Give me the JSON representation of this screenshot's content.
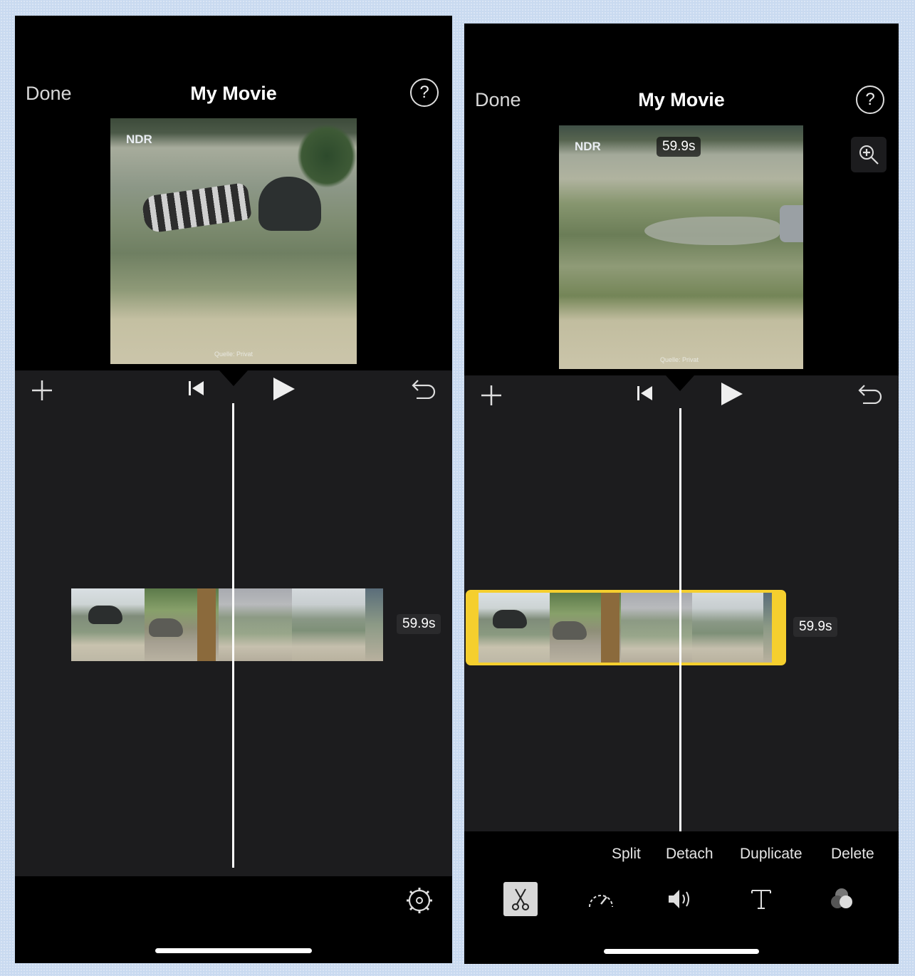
{
  "left": {
    "nav": {
      "done_label": "Done",
      "title": "My Movie",
      "help_label": "?"
    },
    "viewer": {
      "logo": "NDR",
      "credit": "Quelle: Privat"
    },
    "clip": {
      "duration": "59.9s",
      "selected": false
    },
    "icons": [
      "plus-icon",
      "skip-to-start-icon",
      "play-icon",
      "undo-icon",
      "settings-gear-icon"
    ]
  },
  "right": {
    "nav": {
      "done_label": "Done",
      "title": "My Movie",
      "help_label": "?"
    },
    "viewer": {
      "logo": "NDR",
      "time_badge": "59.9s",
      "credit": "Quelle: Privat"
    },
    "clip": {
      "duration": "59.9s",
      "selected": true
    },
    "actions": [
      {
        "label": "Split"
      },
      {
        "label": "Detach"
      },
      {
        "label": "Duplicate"
      },
      {
        "label": "Delete"
      }
    ],
    "tools": [
      "scissors-icon",
      "speed-gauge-icon",
      "volume-icon",
      "text-icon",
      "filters-icon"
    ],
    "colors": {
      "selection": "#f5cf2e",
      "background": "#1c1c1e"
    }
  }
}
